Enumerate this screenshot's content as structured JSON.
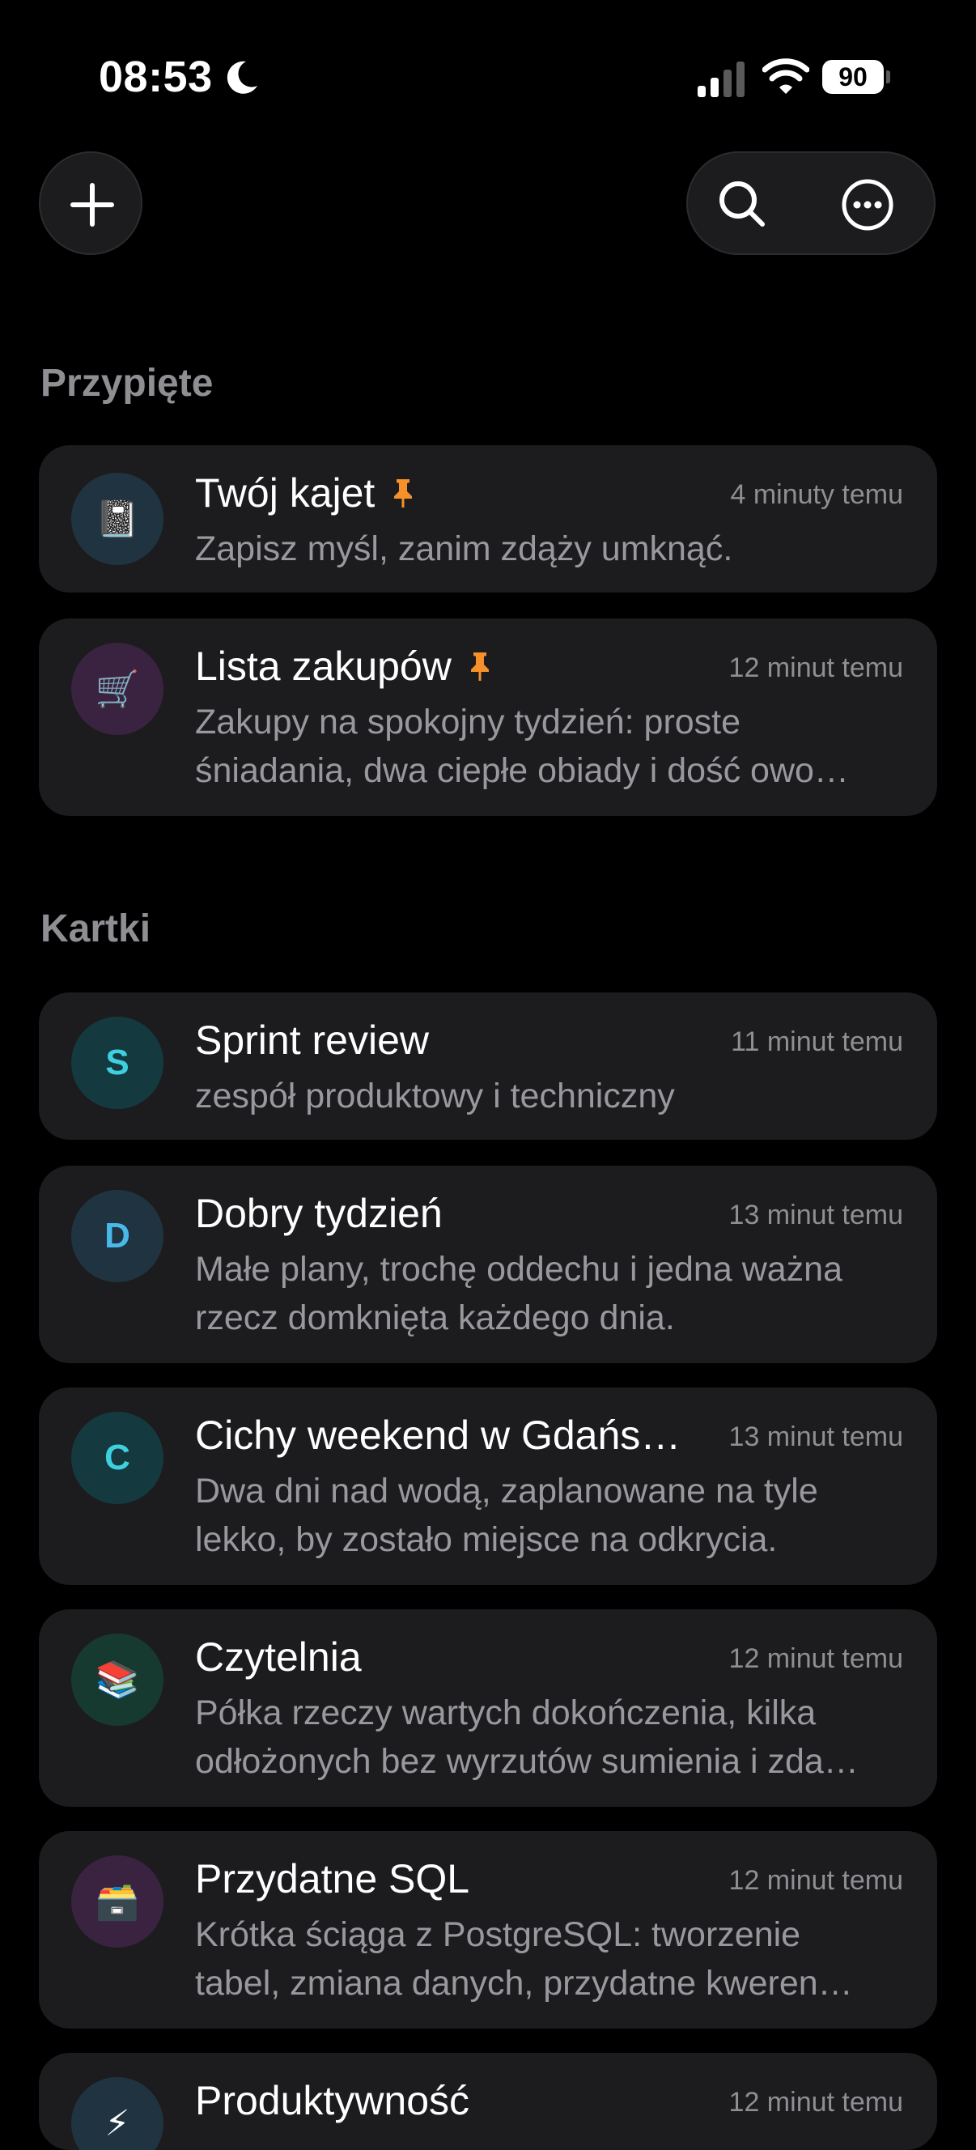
{
  "status_bar": {
    "time": "08:53",
    "battery": "90"
  },
  "toolbar": {
    "add_icon": "plus-icon",
    "search_icon": "search-icon",
    "more_icon": "ellipsis-circle-icon"
  },
  "sections": {
    "pinned": {
      "title": "Przypięte",
      "items": [
        {
          "title": "Twój kajet",
          "time": "4 minuty temu",
          "lines": [
            "Zapisz myśl, zanim zdąży umknąć."
          ],
          "avatar": "📓",
          "avatar_bg": "#1f3440",
          "pinned": true
        },
        {
          "title": "Lista zakupów",
          "time": "12 minut temu",
          "lines": [
            "Zakupy na spokojny tydzień: proste",
            "śniadania, dwa ciepłe obiady i dość owo…"
          ],
          "avatar": "🛒",
          "avatar_bg": "#3a2340",
          "pinned": true
        }
      ]
    },
    "cards": {
      "title": "Kartki",
      "items": [
        {
          "title": "Sprint review",
          "time": "11 minut temu",
          "lines": [
            "zespół produktowy i techniczny"
          ],
          "avatar": "S",
          "avatar_bg": "#143a40",
          "avatar_color": "#3fd0e0"
        },
        {
          "title": "Dobry tydzień",
          "time": "13 minut temu",
          "lines": [
            "Małe plany, trochę oddechu i jedna ważna",
            "rzecz domknięta każdego dnia."
          ],
          "avatar": "D",
          "avatar_bg": "#1f3440",
          "avatar_color": "#4ab8e8"
        },
        {
          "title": "Cichy weekend w Gdańs…",
          "time": "13 minut temu",
          "lines": [
            "Dwa dni nad wodą, zaplanowane na tyle",
            "lekko, by zostało miejsce na odkrycia."
          ],
          "avatar": "C",
          "avatar_bg": "#143a40",
          "avatar_color": "#3fd0e0"
        },
        {
          "title": "Czytelnia",
          "time": "12 minut temu",
          "lines": [
            "Półka rzeczy wartych dokończenia, kilka",
            "odłożonych bez wyrzutów sumienia i zda…"
          ],
          "avatar": "📚",
          "avatar_bg": "#173a30"
        },
        {
          "title": "Przydatne SQL",
          "time": "12 minut temu",
          "lines": [
            "Krótka ściąga z PostgreSQL: tworzenie",
            "tabel, zmiana danych, przydatne kweren…"
          ],
          "avatar": "🗃️",
          "avatar_bg": "#3a2340"
        },
        {
          "title": "Produktywność",
          "time": "12 minut temu",
          "lines": [],
          "avatar": "⚡",
          "avatar_bg": "#1f3440"
        }
      ]
    }
  },
  "colors": {
    "background": "#000000",
    "card": "#1c1c1e",
    "pin": "#f5902a",
    "secondary_text": "#8e8e93"
  }
}
